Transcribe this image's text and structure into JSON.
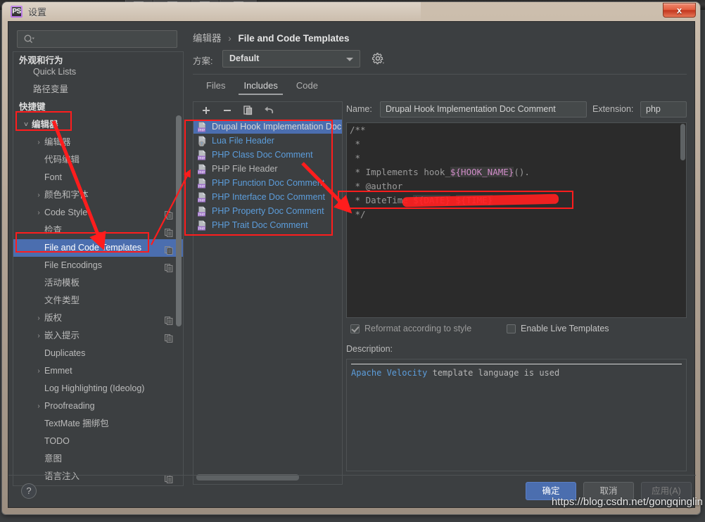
{
  "window": {
    "title": "设置",
    "app_icon_label": "PS",
    "close_label": "x"
  },
  "search": {
    "value": "",
    "placeholder": "",
    "icon": "search-icon"
  },
  "sidebar": {
    "items": [
      {
        "label": "外观和行为",
        "indent": 8,
        "arrow": "",
        "header": true,
        "copy": false,
        "selected": false
      },
      {
        "label": "Quick Lists",
        "indent": 28,
        "arrow": "",
        "header": false,
        "copy": false,
        "selected": false
      },
      {
        "label": "路径变量",
        "indent": 28,
        "arrow": "",
        "header": false,
        "copy": false,
        "selected": false
      },
      {
        "label": "快捷键",
        "indent": 8,
        "arrow": "",
        "header": true,
        "copy": false,
        "selected": false
      },
      {
        "label": "编辑器",
        "indent": 26,
        "arrow": "v",
        "header": true,
        "copy": false,
        "selected": false
      },
      {
        "label": "编辑器",
        "indent": 44,
        "arrow": ">",
        "header": false,
        "copy": false,
        "selected": false
      },
      {
        "label": "代码编辑",
        "indent": 44,
        "arrow": "",
        "header": false,
        "copy": false,
        "selected": false
      },
      {
        "label": "Font",
        "indent": 44,
        "arrow": "",
        "header": false,
        "copy": false,
        "selected": false
      },
      {
        "label": "颜色和字体",
        "indent": 44,
        "arrow": ">",
        "header": false,
        "copy": false,
        "selected": false
      },
      {
        "label": "Code Style",
        "indent": 44,
        "arrow": ">",
        "header": false,
        "copy": true,
        "selected": false
      },
      {
        "label": "检查",
        "indent": 44,
        "arrow": "",
        "header": false,
        "copy": true,
        "selected": false
      },
      {
        "label": "File and Code Templates",
        "indent": 44,
        "arrow": "",
        "header": false,
        "copy": true,
        "selected": true
      },
      {
        "label": "File Encodings",
        "indent": 44,
        "arrow": "",
        "header": false,
        "copy": true,
        "selected": false
      },
      {
        "label": "活动模板",
        "indent": 44,
        "arrow": "",
        "header": false,
        "copy": false,
        "selected": false
      },
      {
        "label": "文件类型",
        "indent": 44,
        "arrow": "",
        "header": false,
        "copy": false,
        "selected": false
      },
      {
        "label": "版权",
        "indent": 44,
        "arrow": ">",
        "header": false,
        "copy": true,
        "selected": false
      },
      {
        "label": "嵌入提示",
        "indent": 44,
        "arrow": ">",
        "header": false,
        "copy": true,
        "selected": false
      },
      {
        "label": "Duplicates",
        "indent": 44,
        "arrow": "",
        "header": false,
        "copy": false,
        "selected": false
      },
      {
        "label": "Emmet",
        "indent": 44,
        "arrow": ">",
        "header": false,
        "copy": false,
        "selected": false
      },
      {
        "label": "Log Highlighting (Ideolog)",
        "indent": 44,
        "arrow": "",
        "header": false,
        "copy": false,
        "selected": false
      },
      {
        "label": "Proofreading",
        "indent": 44,
        "arrow": ">",
        "header": false,
        "copy": false,
        "selected": false
      },
      {
        "label": "TextMate 捆绑包",
        "indent": 44,
        "arrow": "",
        "header": false,
        "copy": false,
        "selected": false
      },
      {
        "label": "TODO",
        "indent": 44,
        "arrow": "",
        "header": false,
        "copy": false,
        "selected": false
      },
      {
        "label": "意图",
        "indent": 44,
        "arrow": "",
        "header": false,
        "copy": false,
        "selected": false
      },
      {
        "label": "语言注入",
        "indent": 44,
        "arrow": "",
        "header": false,
        "copy": true,
        "selected": false
      }
    ]
  },
  "breadcrumb": {
    "parent": "编辑器",
    "separator": "›",
    "current": "File and Code Templates"
  },
  "scheme": {
    "label": "方案:",
    "value": "Default",
    "gear_icon": "gear-icon"
  },
  "tabs": [
    {
      "label": "Files",
      "active": false
    },
    {
      "label": "Includes",
      "active": true
    },
    {
      "label": "Code",
      "active": false
    }
  ],
  "list_toolbar": [
    {
      "name": "add-template-button",
      "glyph": "+"
    },
    {
      "name": "remove-template-button",
      "glyph": "−"
    },
    {
      "name": "copy-template-button",
      "glyph": "copy"
    },
    {
      "name": "reset-template-button",
      "glyph": "undo"
    }
  ],
  "templates": [
    {
      "label": "Drupal Hook Implementation Doc Comment",
      "icon": "php-file-icon",
      "modified": true,
      "selected": true
    },
    {
      "label": "Lua File Header",
      "icon": "unknown-file-icon",
      "modified": true,
      "selected": false
    },
    {
      "label": "PHP Class Doc Comment",
      "icon": "php-file-icon",
      "modified": true,
      "selected": false
    },
    {
      "label": "PHP File Header",
      "icon": "php-file-icon",
      "modified": false,
      "selected": false
    },
    {
      "label": "PHP Function Doc Comment",
      "icon": "php-file-icon",
      "modified": true,
      "selected": false
    },
    {
      "label": "PHP Interface Doc Comment",
      "icon": "php-file-icon",
      "modified": true,
      "selected": false
    },
    {
      "label": "PHP Property Doc Comment",
      "icon": "php-file-icon",
      "modified": true,
      "selected": false
    },
    {
      "label": "PHP Trait Doc Comment",
      "icon": "php-file-icon",
      "modified": true,
      "selected": false
    }
  ],
  "editor": {
    "name_label": "Name:",
    "name_value": "Drupal Hook Implementation Doc Comment",
    "extension_label": "Extension:",
    "extension_value": "php",
    "code_lines": [
      {
        "segments": [
          {
            "t": "/**",
            "k": "cmt"
          }
        ]
      },
      {
        "segments": [
          {
            "t": " *",
            "k": "cmt"
          }
        ]
      },
      {
        "segments": [
          {
            "t": " *",
            "k": "cmt"
          }
        ]
      },
      {
        "segments": [
          {
            "t": " * Implements hook_",
            "k": "cmt"
          },
          {
            "t": "${HOOK_NAME}",
            "k": "var"
          },
          {
            "t": "().",
            "k": "cmt"
          }
        ]
      },
      {
        "segments": [
          {
            "t": " * @author ",
            "k": "cmt"
          },
          {
            "t": "",
            "k": "redacted"
          }
        ]
      },
      {
        "segments": [
          {
            "t": " * DateTime ",
            "k": "cmt"
          },
          {
            "t": "${DATE}",
            "k": "var"
          },
          {
            "t": " ",
            "k": "cmt"
          },
          {
            "t": "${TIME}",
            "k": "var"
          }
        ]
      },
      {
        "segments": [
          {
            "t": " */",
            "k": "cmt"
          }
        ]
      }
    ]
  },
  "options": {
    "reformat": {
      "label": "Reformat according to style",
      "checked": true,
      "enabled": false
    },
    "live_templates": {
      "label": "Enable Live Templates",
      "checked": false,
      "enabled": true
    }
  },
  "description": {
    "label": "Description:",
    "link_text": "Apache Velocity",
    "rest_text": " template language is used"
  },
  "footer": {
    "help_label": "?",
    "ok_label": "确定",
    "cancel_label": "取消",
    "apply_label": "应用(A)"
  },
  "watermark": {
    "text": "https://blog.csdn.net/gongqinglin"
  },
  "colors": {
    "accent_blue": "#4b6eaf",
    "link_blue": "#5c9ddb",
    "panel_bg": "#3c3f41",
    "editor_bg": "#2b2b2b",
    "annotation_red": "#ff1d1d",
    "variable_pink": "#d08cc8"
  }
}
